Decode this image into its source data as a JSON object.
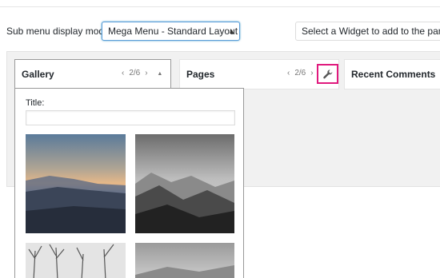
{
  "toolbar": {
    "submenu_label": "Sub menu display mode",
    "mode_select_value": "Mega Menu - Standard Layout",
    "widget_select_value": "Select a Widget to add to the panel"
  },
  "widgets": [
    {
      "title": "Gallery",
      "page": "2/6",
      "expanded": true
    },
    {
      "title": "Pages",
      "page": "2/6",
      "expanded": false
    },
    {
      "title": "Recent Comments"
    }
  ],
  "gallery_settings": {
    "title_label": "Title:",
    "title_value": ""
  },
  "icons": {
    "prev": "chevron-left-icon",
    "next": "chevron-right-icon",
    "collapse": "triangle-up-icon",
    "settings": "wrench-icon",
    "select": "select-arrows-icon"
  },
  "colors": {
    "highlight": "#e0197d",
    "focus": "#5b9dd9"
  }
}
